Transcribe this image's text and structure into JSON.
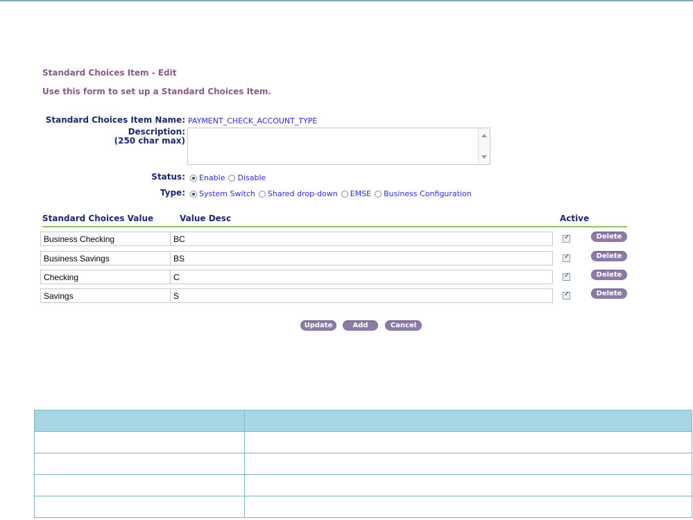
{
  "page": {
    "title": "Standard Choices Item - Edit",
    "subtitle": "Use this form to set up a Standard Choices Item."
  },
  "form": {
    "name_label": "Standard Choices Item Name:",
    "name_value": "PAYMENT_CHECK_ACCOUNT_TYPE",
    "description_label": "Description:",
    "description_hint": "(250 char max)",
    "description_value": "",
    "status_label": "Status:",
    "status_options": [
      "Enable",
      "Disable"
    ],
    "status_selected": "Enable",
    "type_label": "Type:",
    "type_options": [
      "System Switch",
      "Shared drop-down",
      "EMSE",
      "Business Configuration"
    ],
    "type_selected": "System Switch"
  },
  "grid": {
    "headers": {
      "value": "Standard Choices Value",
      "desc": "Value Desc",
      "active": "Active"
    },
    "rows": [
      {
        "value": "Business Checking",
        "desc": "BC",
        "active": true
      },
      {
        "value": "Business Savings",
        "desc": "BS",
        "active": true
      },
      {
        "value": "Checking",
        "desc": "C",
        "active": true
      },
      {
        "value": "Savings",
        "desc": "S",
        "active": true
      }
    ],
    "delete_label": "Delete"
  },
  "actions": {
    "update": "Update",
    "add": "Add",
    "cancel": "Cancel"
  },
  "colors": {
    "title": "#8a5a8a",
    "label": "#1a2a6c",
    "value": "#2b2bd6",
    "rule": "#8fc46a",
    "button": "#8c7aa9",
    "table_header": "#a7d6e4"
  }
}
